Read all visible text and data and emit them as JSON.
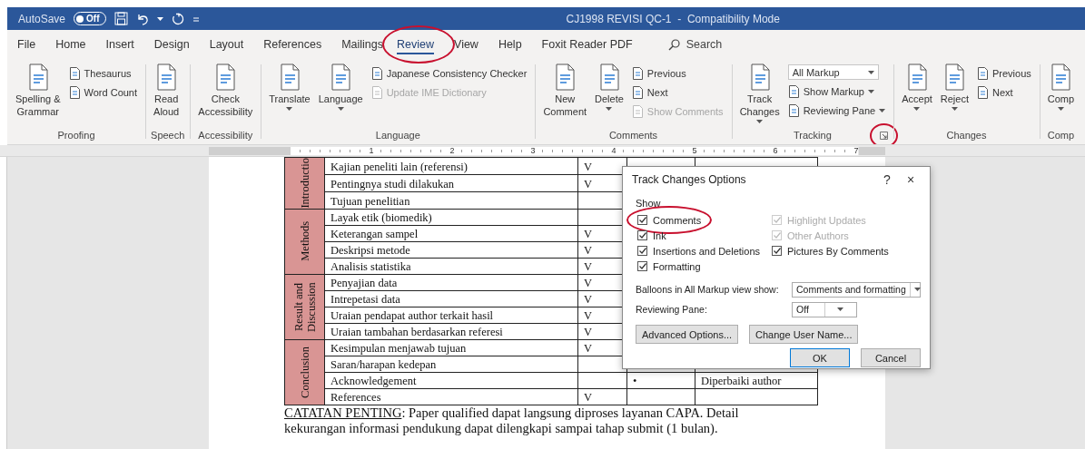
{
  "title_bar": {
    "autosave": {
      "label": "AutoSave",
      "state": "Off",
      "on": false
    },
    "title": "CJ1998 REVISI QC-1  -  Compatibility Mode"
  },
  "tabs": [
    {
      "label": "File",
      "selected": false,
      "circled": false
    },
    {
      "label": "Home",
      "selected": false,
      "circled": false
    },
    {
      "label": "Insert",
      "selected": false,
      "circled": false
    },
    {
      "label": "Design",
      "selected": false,
      "circled": false
    },
    {
      "label": "Layout",
      "selected": false,
      "circled": false
    },
    {
      "label": "References",
      "selected": false,
      "circled": false
    },
    {
      "label": "Mailings",
      "selected": false,
      "circled": false
    },
    {
      "label": "Review",
      "selected": true,
      "circled": true
    },
    {
      "label": "View",
      "selected": false,
      "circled": false
    },
    {
      "label": "Help",
      "selected": false,
      "circled": false
    },
    {
      "label": "Foxit Reader PDF",
      "selected": false,
      "circled": false
    }
  ],
  "search": {
    "placeholder": "Search"
  },
  "ribbon": {
    "groups": [
      {
        "label": "Proofing",
        "items": [
          {
            "kind": "large",
            "label": "Spelling &\nGrammar",
            "dropdown": false,
            "disabled": false
          },
          {
            "kind": "column",
            "items": [
              {
                "kind": "small",
                "label": "Thesaurus",
                "dropdown": false,
                "disabled": false
              },
              {
                "kind": "small",
                "label": "Word Count",
                "dropdown": false,
                "disabled": false
              }
            ]
          }
        ]
      },
      {
        "label": "Speech",
        "items": [
          {
            "kind": "large",
            "label": "Read\nAloud",
            "dropdown": false,
            "disabled": false
          }
        ]
      },
      {
        "label": "Accessibility",
        "items": [
          {
            "kind": "large",
            "label": "Check\nAccessibility",
            "dropdown": false,
            "disabled": false
          }
        ]
      },
      {
        "label": "Language",
        "items": [
          {
            "kind": "large",
            "label": "Translate",
            "dropdown": true,
            "disabled": false
          },
          {
            "kind": "large",
            "label": "Language",
            "dropdown": true,
            "disabled": false
          },
          {
            "kind": "column",
            "items": [
              {
                "kind": "small",
                "label": "Japanese Consistency Checker",
                "dropdown": false,
                "disabled": false
              },
              {
                "kind": "small",
                "label": "Update IME Dictionary",
                "dropdown": false,
                "disabled": true
              }
            ]
          }
        ]
      },
      {
        "label": "Comments",
        "items": [
          {
            "kind": "large",
            "label": "New\nComment",
            "dropdown": false,
            "disabled": false
          },
          {
            "kind": "large",
            "label": "Delete",
            "dropdown": true,
            "disabled": false
          },
          {
            "kind": "column",
            "items": [
              {
                "kind": "small",
                "label": "Previous",
                "dropdown": false,
                "disabled": false
              },
              {
                "kind": "small",
                "label": "Next",
                "dropdown": false,
                "disabled": false
              },
              {
                "kind": "small",
                "label": "Show Comments",
                "dropdown": false,
                "disabled": true
              }
            ]
          }
        ]
      },
      {
        "label": "Tracking",
        "launcher": {
          "circled": true
        },
        "items": [
          {
            "kind": "large",
            "label": "Track\nChanges",
            "dropdown": true,
            "disabled": false
          },
          {
            "kind": "column",
            "items": [
              {
                "kind": "select",
                "value": "All Markup"
              },
              {
                "kind": "small",
                "label": "Show Markup",
                "dropdown": true,
                "disabled": false
              },
              {
                "kind": "small",
                "label": "Reviewing Pane",
                "dropdown": true,
                "disabled": false
              }
            ]
          }
        ]
      },
      {
        "label": "Changes",
        "items": [
          {
            "kind": "large",
            "label": "Accept",
            "dropdown": true,
            "disabled": false
          },
          {
            "kind": "large",
            "label": "Reject",
            "dropdown": true,
            "disabled": false
          },
          {
            "kind": "column",
            "items": [
              {
                "kind": "small",
                "label": "Previous",
                "dropdown": false,
                "disabled": false
              },
              {
                "kind": "small",
                "label": "Next",
                "dropdown": false,
                "disabled": false
              }
            ]
          }
        ]
      },
      {
        "label": "Comp",
        "items": [
          {
            "kind": "large",
            "label": "Comp",
            "dropdown": true,
            "disabled": false
          }
        ]
      }
    ]
  },
  "ruler": {
    "numbers": [
      "1",
      "2",
      "3",
      "4",
      "5",
      "6",
      "7"
    ]
  },
  "table": {
    "sections": [
      {
        "label": "Introductio",
        "rows": [
          {
            "item": "Kajian peneliti lain (referensi)",
            "check": "V"
          },
          {
            "item": "Pentingnya studi dilakukan",
            "check": "V"
          },
          {
            "item": "Tujuan penelitian"
          }
        ]
      },
      {
        "label": "Methods",
        "rows": [
          {
            "item": "Layak etik (biomedik)"
          },
          {
            "item": "Keterangan sampel",
            "check": "V"
          },
          {
            "item": "Deskripsi metode",
            "check": "V"
          },
          {
            "item": "Analisis statistika",
            "check": "V"
          }
        ]
      },
      {
        "label": "Result and Discussion",
        "rows": [
          {
            "item": "Penyajian data",
            "check": "V"
          },
          {
            "item": "Intrepetasi data",
            "check": "V"
          },
          {
            "item": "Uraian pendapat author terkait hasil",
            "check": "V"
          },
          {
            "item": "Uraian tambahan berdasarkan referesi",
            "check": "V"
          }
        ]
      },
      {
        "label": "Conclusion",
        "rows": [
          {
            "item": "Kesimpulan menjawab tujuan",
            "check": "V"
          },
          {
            "item": "Saran/harapan kedepan"
          },
          {
            "item": "Acknowledgement",
            "column_4": "•",
            "column_5": "Diperbaiki author"
          },
          {
            "item": "References",
            "check": "V"
          }
        ]
      }
    ]
  },
  "note": {
    "label": "CATATAN PENTING",
    "text": ": Paper qualified dapat langsung diproses layanan CAPA. Detail kekurangan informasi pendukung dapat dilengkapi sampai tahap submit (1 bulan)."
  },
  "dialog": {
    "title": "Track Changes Options",
    "help": "?",
    "close": "×",
    "show_label": "Show",
    "left_checkboxes": [
      {
        "label": "Comments",
        "checked": true,
        "disabled": false,
        "circled": true
      },
      {
        "label": "Ink",
        "checked": true,
        "disabled": false,
        "circled": false
      },
      {
        "label": "Insertions and Deletions",
        "checked": true,
        "disabled": false,
        "circled": false
      },
      {
        "label": "Formatting",
        "checked": true,
        "disabled": false,
        "circled": false
      }
    ],
    "right_checkboxes": [
      {
        "label": "Highlight Updates",
        "checked": true,
        "disabled": true,
        "circled": false
      },
      {
        "label": "Other Authors",
        "checked": true,
        "disabled": true,
        "circled": false
      },
      {
        "label": "Pictures By Comments",
        "checked": true,
        "disabled": false,
        "circled": false
      }
    ],
    "fields": [
      {
        "label": "Balloons in All Markup view show:",
        "value": "Comments and formatting"
      },
      {
        "label": "Reviewing Pane:",
        "value": "Off"
      }
    ],
    "option_buttons": [
      {
        "label": "Advanced Options...",
        "default": false
      },
      {
        "label": "Change User Name...",
        "default": false
      }
    ],
    "buttons": [
      {
        "label": "OK",
        "default": true
      },
      {
        "label": "Cancel",
        "default": false
      }
    ]
  }
}
